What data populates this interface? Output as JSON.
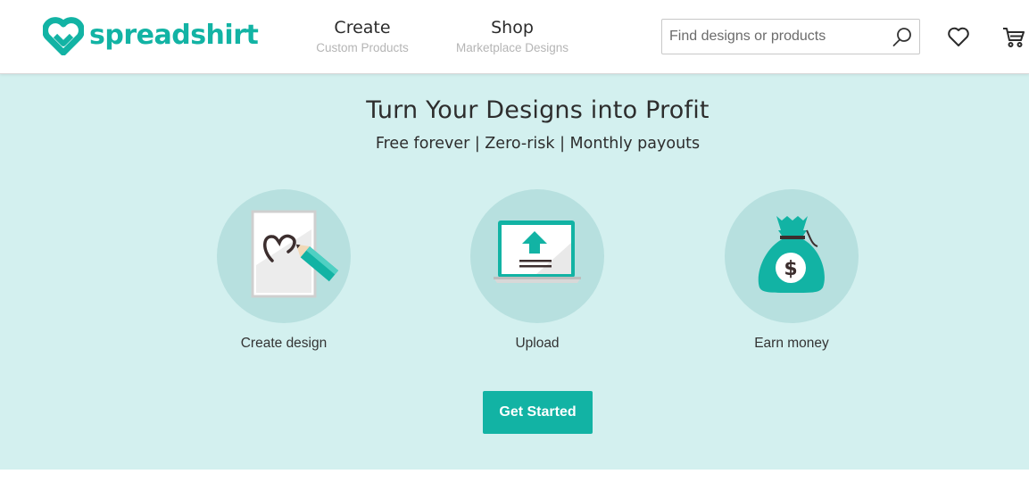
{
  "header": {
    "logo_text": "spreadshirt",
    "nav": [
      {
        "title": "Create",
        "subtitle": "Custom Products"
      },
      {
        "title": "Shop",
        "subtitle": "Marketplace Designs"
      }
    ],
    "search": {
      "placeholder": "Find designs or products",
      "value": ""
    },
    "icons": [
      "search-icon",
      "heart-icon",
      "cart-icon"
    ]
  },
  "hero": {
    "title": "Turn Your Designs into Profit",
    "subtitle": "Free forever | Zero-risk | Monthly payouts",
    "steps": [
      {
        "label": "Create design",
        "icon": "design-pencil-icon"
      },
      {
        "label": "Upload",
        "icon": "laptop-upload-icon"
      },
      {
        "label": "Earn money",
        "icon": "money-bag-icon"
      }
    ],
    "cta_label": "Get Started"
  },
  "colors": {
    "brand": "#12b3a4",
    "hero_bg": "#d3f0ef",
    "circle_bg": "#b7e0df",
    "text_dark": "#2d2d2d"
  }
}
